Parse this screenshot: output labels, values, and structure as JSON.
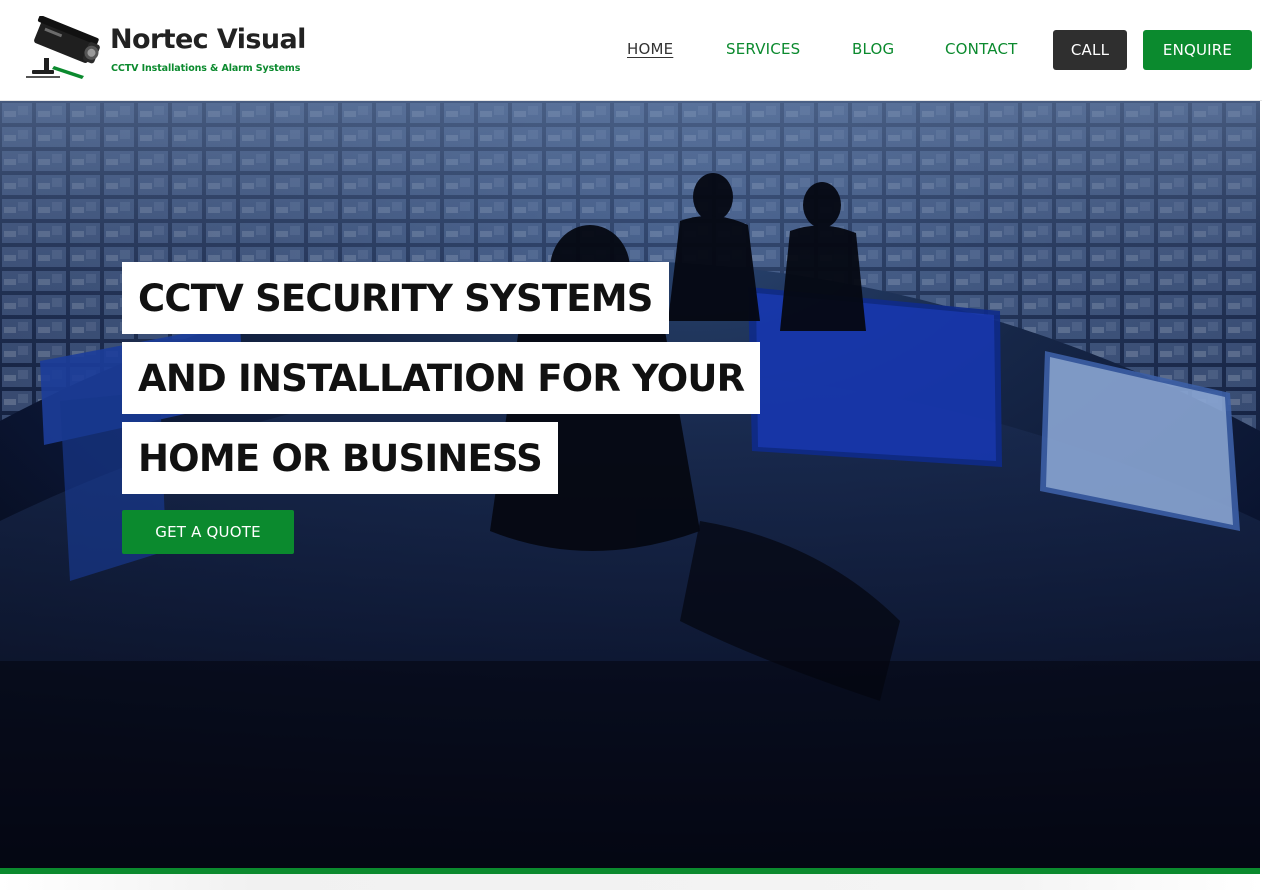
{
  "brand": {
    "name": "Nortec Visual",
    "tagline": "CCTV Installations & Alarm Systems",
    "logo_icon": "cctv-camera-icon"
  },
  "nav": {
    "items": [
      {
        "label": "HOME",
        "active": true
      },
      {
        "label": "SERVICES",
        "active": false
      },
      {
        "label": "BLOG",
        "active": false
      },
      {
        "label": "CONTACT",
        "active": false
      }
    ],
    "call_label": "CALL",
    "enquire_label": "ENQUIRE"
  },
  "hero": {
    "headline_lines": [
      "CCTV SECURITY SYSTEMS",
      "AND INSTALLATION FOR YOUR",
      "HOME OR BUSINESS"
    ],
    "cta_label": "GET A QUOTE",
    "background": "security-control-room-photo"
  },
  "colors": {
    "brand_green": "#0b8a2e",
    "call_button": "#2f2f2f",
    "nav_active": "#333333",
    "hero_overlay": "#070d1e"
  }
}
